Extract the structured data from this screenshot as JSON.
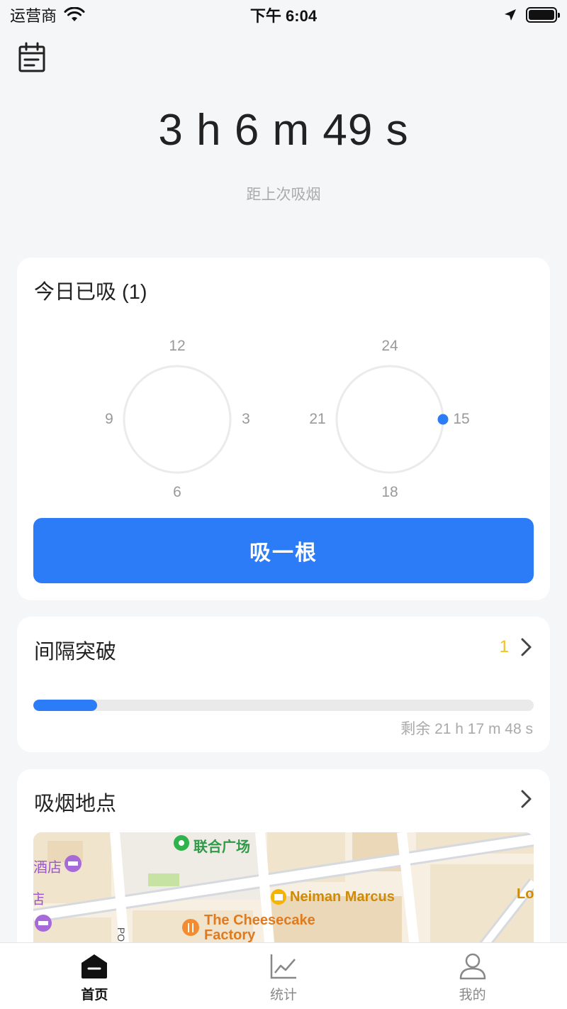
{
  "status_bar": {
    "carrier": "运营商",
    "time": "下午 6:04"
  },
  "timer": {
    "value": "3 h 6 m 49 s",
    "subtitle": "距上次吸烟"
  },
  "today": {
    "title": "今日已吸 (1)",
    "clock_am": {
      "top": "12",
      "right": "3",
      "bottom": "6",
      "left": "9"
    },
    "clock_pm": {
      "top": "24",
      "right": "15",
      "bottom": "18",
      "left": "21"
    },
    "pm_dot_hour": 15,
    "button_label": "吸一根"
  },
  "interval": {
    "title": "间隔突破",
    "count": "1",
    "progress": 0.127,
    "remaining": "剩余 21 h 17 m 48 s"
  },
  "location": {
    "title": "吸烟地点",
    "map_labels": {
      "plaza": "联合广场",
      "store": "Neiman Marcus",
      "restaurant_line1": "The Cheesecake",
      "restaurant_line2": "Factory",
      "hotel": "酒店",
      "hotel_partial": "店",
      "edge_partial": "Lo",
      "street": "PO"
    }
  },
  "tabs": [
    {
      "label": "首页",
      "icon": "home-icon",
      "active": true
    },
    {
      "label": "统计",
      "icon": "chart-icon",
      "active": false
    },
    {
      "label": "我的",
      "icon": "person-icon",
      "active": false
    }
  ],
  "colors": {
    "accent": "#2b7cf6",
    "highlight": "#f4c01b",
    "background": "#f5f6f8"
  }
}
